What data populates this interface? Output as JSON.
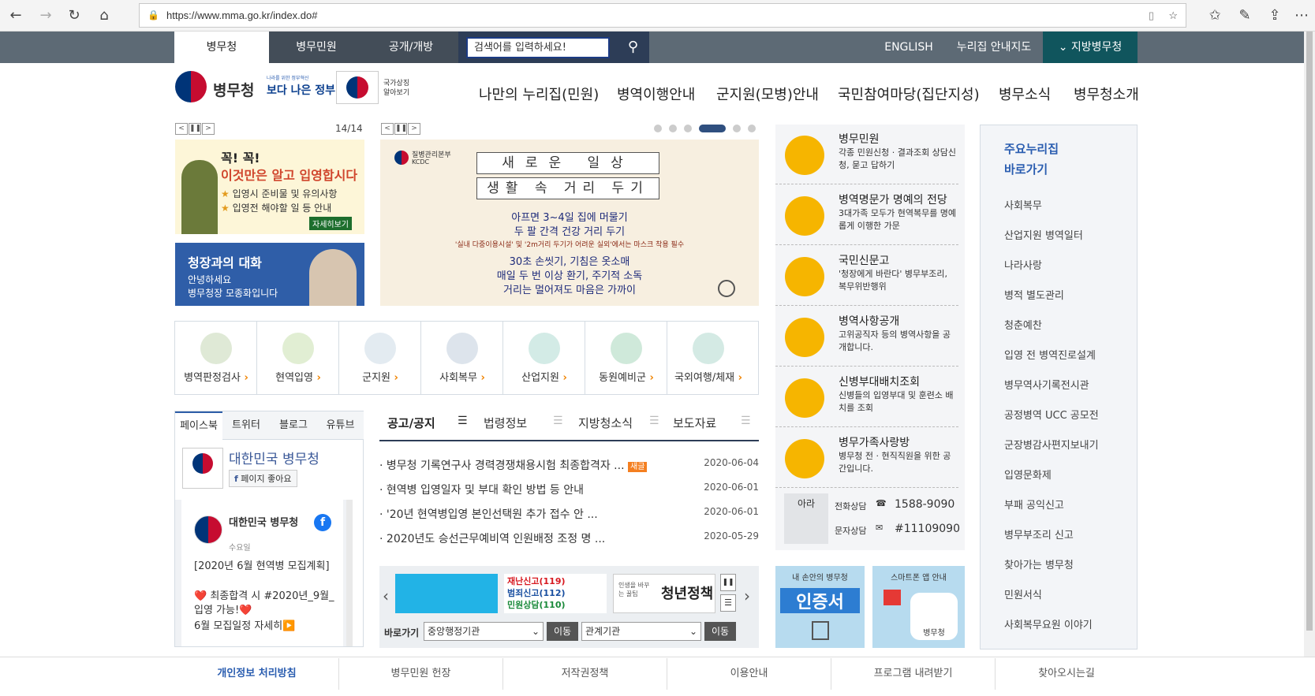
{
  "browser": {
    "url": "https://www.mma.go.kr/index.do#"
  },
  "util_bar": {
    "tabs": [
      "병무청",
      "병무민원",
      "공개/개방"
    ],
    "search_placeholder": "검색어를 입력하세요!",
    "english": "ENGLISH",
    "sitemap": "누리집 안내지도",
    "regional": "⌄ 지방병무청"
  },
  "logo": {
    "name": "병무청",
    "gov_slogan": "보다 나은 정부",
    "gov_small": "나라를 위한 정부혁신",
    "symbol_text": "국가상징 알아보기"
  },
  "nav": [
    "나만의 누리집(민원)",
    "병역이행안내",
    "군지원(모병)안내",
    "국민참여마당(집단지성)",
    "병무소식",
    "병무청소개"
  ],
  "left_banner": {
    "counter": "14/14",
    "line1": "꼭! 꼭!",
    "line2": "이것만은 알고 입영합시다",
    "bullet1": "입영시 준비물 및 유의사항",
    "bullet2": "입영전 해야할 일 등 안내",
    "more": "자세히보기"
  },
  "commissioner": {
    "title": "청장과의 대화",
    "line1": "안녕하세요",
    "line2": "병무청장 모종화입니다"
  },
  "center_banner": {
    "org": "질병관리본부",
    "org_en": "KCDC",
    "headline1": "새로운 일상",
    "headline2": "생활 속 거리 두기",
    "l1": "아프면 3~4일 집에 머물기",
    "l2": "두 팔 간격 건강 거리 두기",
    "l3": "'실내 다중이용시설' 및 '2m거리 두기가 어려운 실외'에서는 마스크 착용 필수",
    "l4": "30초 손씻기, 기침은 옷소매",
    "l5": "매일 두 번 이상 환기, 주기적 소독",
    "l6": "거리는 멀어져도 마음은 가까이"
  },
  "quick_menu": [
    "병역판정검사",
    "현역입영",
    "군지원",
    "사회복무",
    "산업지원",
    "동원예비군",
    "국외여행/체재"
  ],
  "sns": {
    "tabs": [
      "페이스북",
      "트위터",
      "블로그",
      "유튜브"
    ],
    "page_name": "대한민국 병무청",
    "like": "페이지 좋아요",
    "post_author": "대한민국 병무청",
    "post_day": "수요일",
    "post_text1": "[2020년 6월 현역병 모집계획]",
    "post_text2": "❤️ 최종합격 시 #2020년_9월_입영 가능!❤️",
    "post_text3": "6월 모집일정 자세히▶️"
  },
  "board": {
    "tabs": [
      "공고/공지",
      "법령정보",
      "지방청소식",
      "보도자료"
    ],
    "items": [
      {
        "title": "병무청 기록연구사 경력경쟁채용시험 최종합격자 ...",
        "badge": "새글",
        "date": "2020-06-04"
      },
      {
        "title": "현역병 입영일자 및 부대 확인 방법 등 안내",
        "badge": "",
        "date": "2020-06-01"
      },
      {
        "title": "'20년 현역병입영 본인선택원 추가 접수 안 ...",
        "badge": "",
        "date": "2020-06-01"
      },
      {
        "title": "2020년도 승선근무예비역 인원배정 조정 명 ...",
        "badge": "",
        "date": "2020-05-29"
      }
    ]
  },
  "mini_banners": {
    "b2a": "재난신고(119)",
    "b2b": "범죄신고(112)",
    "b2c": "민원상담(110)",
    "b3a": "인생을 바꾸는 꿀팁",
    "b3b": "청년정책"
  },
  "shortcut": {
    "label": "바로가기",
    "select1": "중앙행정기관",
    "select2": "관계기관",
    "go": "이동"
  },
  "side_services": [
    {
      "title": "병무민원",
      "desc": "각종 민원신청 · 결과조회 상담신청, 묻고 답하기"
    },
    {
      "title": "병역명문가 명예의 전당",
      "desc": "3대가족 모두가 현역복무를 명예롭게 이행한 가문"
    },
    {
      "title": "국민신문고",
      "desc": "'청장에게 바란다' 병무부조리, 복무위반행위"
    },
    {
      "title": "병역사항공개",
      "desc": "고위공직자 등의 병역사항을 공개합니다."
    },
    {
      "title": "신병부대배치조회",
      "desc": "신병들의 입영부대 및 훈련소 배치를 조회"
    },
    {
      "title": "병무가족사랑방",
      "desc": "병무청 전 · 현직직원을 위한 공간입니다."
    }
  ],
  "contact": {
    "mascot": "아라",
    "phone_label": "전화상담",
    "phone": "1588-9090",
    "sms_label": "문자상담",
    "sms": "#11109090"
  },
  "apps": {
    "cert_title": "내 손안의 병무청",
    "cert_text": "인증서",
    "app_title": "스마트폰 앱 안내",
    "app_logo": "병무청"
  },
  "quick_links": {
    "title1": "주요누리집",
    "title2": "바로가기",
    "items": [
      "사회복무",
      "산업지원 병역일터",
      "나라사랑",
      "병적 별도관리",
      "청춘예찬",
      "입영 전 병역진로설계",
      "병무역사기록전시관",
      "공정병역 UCC 공모전",
      "군장병감사편지보내기",
      "입영문화제",
      "부패 공익신고",
      "병무부조리 신고",
      "찾아가는 병무청",
      "민원서식",
      "사회복무요원 이야기"
    ]
  },
  "footer": [
    "개인정보 처리방침",
    "병무민원 헌장",
    "저작권정책",
    "이용안내",
    "프로그램 내려받기",
    "찾아오시는길"
  ]
}
